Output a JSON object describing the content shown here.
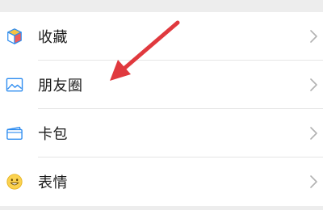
{
  "menu": {
    "items": [
      {
        "label": "收藏",
        "icon": "favorites-cube-icon"
      },
      {
        "label": "朋友圈",
        "icon": "moments-image-icon"
      },
      {
        "label": "卡包",
        "icon": "card-wallet-icon"
      },
      {
        "label": "表情",
        "icon": "smiley-sticker-icon"
      }
    ],
    "chevron_icon": "chevron-right-icon"
  },
  "annotation": {
    "arrow_color": "#e0393e",
    "points_to": "朋友圈"
  },
  "colors": {
    "background": "#ededed",
    "card": "#ffffff",
    "text": "#1a1a1a",
    "divider": "#e5e5e5",
    "chevron": "#b2b2b2"
  }
}
